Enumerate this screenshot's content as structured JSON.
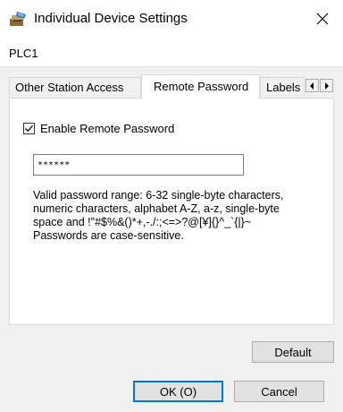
{
  "window": {
    "title": "Individual Device Settings",
    "icon": "device-settings-icon",
    "close_icon": "close-icon"
  },
  "device_name": "PLC1",
  "tabs": [
    {
      "label": "Other Station Access",
      "active": false
    },
    {
      "label": "Remote Password",
      "active": true
    },
    {
      "label": "Labels",
      "active": false
    }
  ],
  "tab_scroll": {
    "left": "chevron-left-icon",
    "right": "chevron-right-icon"
  },
  "remote_password": {
    "enable_label": "Enable Remote Password",
    "enabled": true,
    "password_value": "******",
    "description_lines": [
      "Valid password range: 6-32 single-byte characters,",
      "numeric characters, alphabet A-Z, a-z, single-byte",
      "space and !\"#$%&()*+,-./:;<=>?@[¥]{}^_`{|}~",
      "Passwords are case-sensitive."
    ]
  },
  "buttons": {
    "default_label": "Default",
    "ok_label": "OK (O)",
    "cancel_label": "Cancel"
  },
  "colors": {
    "accent": "#0078d7",
    "dialog_bg": "#f0f0f0"
  }
}
